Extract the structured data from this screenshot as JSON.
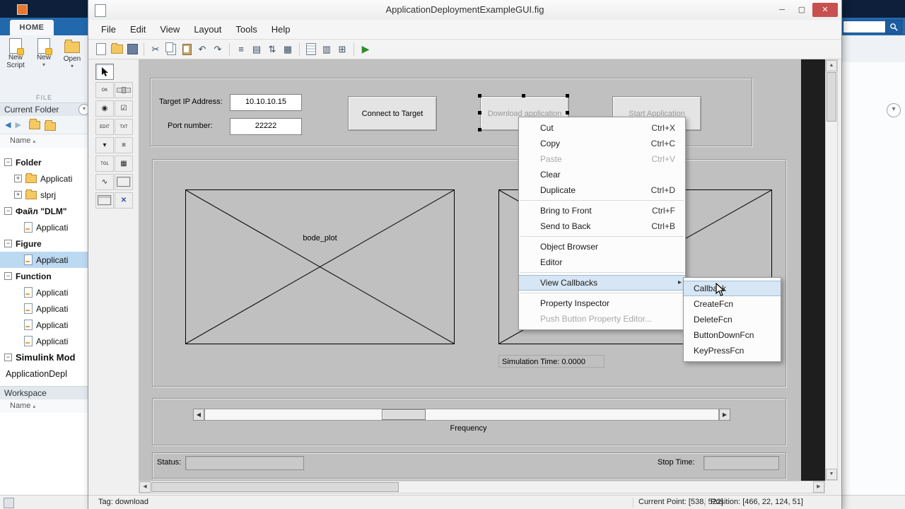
{
  "colors": {
    "titlebar_navy": "#0d1f3a",
    "ribbon_blue": "#2268ad",
    "close_red": "#c75050",
    "canvas_gray": "#c0c0c0",
    "selection_blue": "#bcd9f2",
    "menu_highlight": "#d7e6f4",
    "run_green": "#2e8b2e"
  },
  "glyphs": {
    "minimize": "─",
    "maximize": "▢",
    "close": "✕",
    "sort_asc": "▴",
    "dropdown": "▾",
    "submenu_arrow": "▸",
    "up": "▲",
    "down": "▼",
    "left": "◀",
    "right": "▶",
    "back": "◀",
    "forward": "▶",
    "cut": "✂",
    "undo": "↶",
    "redo": "↷",
    "run": "▶",
    "align": "≡",
    "menu_editor": "▤",
    "tab_order": "⇅",
    "toolbar_editor": "▦",
    "prop_inspector": "▥",
    "obj_browser": "⊞",
    "help_circle": "▾"
  },
  "matlab": {
    "ribbon": {
      "tab_home": "HOME",
      "new_script_line1": "New",
      "new_script_line2": "Script",
      "new_label": "New",
      "open_label": "Open",
      "section_file": "FILE"
    },
    "current_folder": {
      "title": "Current Folder",
      "name_header": "Name",
      "rows": [
        {
          "label": "Folder",
          "expander": "−"
        },
        {
          "label": "Applicati",
          "expander": "+"
        },
        {
          "label": "slprj",
          "expander": "+"
        },
        {
          "label": "Файл \"DLM\"",
          "expander": "−"
        },
        {
          "label": "Applicati",
          "expander": ""
        },
        {
          "label": "Figure",
          "expander": "−"
        },
        {
          "label": "Applicati",
          "expander": ""
        },
        {
          "label": "Function",
          "expander": "−"
        },
        {
          "label": "Applicati",
          "expander": ""
        },
        {
          "label": "Applicati",
          "expander": ""
        },
        {
          "label": "Applicati",
          "expander": ""
        },
        {
          "label": "Applicati",
          "expander": ""
        },
        {
          "label": "Simulink Mod",
          "expander": "−"
        },
        {
          "label": "ApplicationDepl",
          "expander": ""
        }
      ]
    },
    "workspace": {
      "title": "Workspace",
      "name_header": "Name"
    }
  },
  "guide": {
    "window_title": "ApplicationDeploymentExampleGUI.fig",
    "menubar": [
      "File",
      "Edit",
      "View",
      "Layout",
      "Tools",
      "Help"
    ],
    "palette": [
      {
        "name": "select-tool",
        "glyph": ""
      },
      {
        "name": "push-button-tool",
        "glyph": "OK"
      },
      {
        "name": "slider-tool",
        "glyph": ""
      },
      {
        "name": "radio-button-tool",
        "glyph": "◉"
      },
      {
        "name": "check-box-tool",
        "glyph": "☑"
      },
      {
        "name": "edit-text-tool",
        "glyph": "EDIT"
      },
      {
        "name": "static-text-tool",
        "glyph": "TXT"
      },
      {
        "name": "pop-up-menu-tool",
        "glyph": "▾"
      },
      {
        "name": "listbox-tool",
        "glyph": "≡"
      },
      {
        "name": "toggle-button-tool",
        "glyph": "TGL"
      },
      {
        "name": "table-tool",
        "glyph": "▦"
      },
      {
        "name": "axes-tool",
        "glyph": "∿"
      },
      {
        "name": "panel-tool",
        "glyph": ""
      },
      {
        "name": "button-group-tool",
        "glyph": ""
      },
      {
        "name": "activex-tool",
        "glyph": "✕"
      }
    ],
    "canvas": {
      "target_ip_label": "Target IP Address:",
      "target_ip_value": "10.10.10.15",
      "port_label": "Port number:",
      "port_value": "22222",
      "connect_button": "Connect to Target",
      "download_button": "Download application",
      "start_button": "Start Application",
      "axes_tag": "bode_plot",
      "simulation_time": "Simulation Time: 0.0000",
      "frequency_label": "Frequency",
      "status_label": "Status:",
      "stop_time_label": "Stop Time:"
    },
    "context_menu": [
      {
        "label": "Cut",
        "shortcut": "Ctrl+X"
      },
      {
        "label": "Copy",
        "shortcut": "Ctrl+C"
      },
      {
        "label": "Paste",
        "shortcut": "Ctrl+V"
      },
      {
        "label": "Clear",
        "shortcut": ""
      },
      {
        "label": "Duplicate",
        "shortcut": "Ctrl+D"
      },
      {
        "label": "Bring to Front",
        "shortcut": "Ctrl+F"
      },
      {
        "label": "Send to Back",
        "shortcut": "Ctrl+B"
      },
      {
        "label": "Object Browser",
        "shortcut": ""
      },
      {
        "label": "Editor",
        "shortcut": ""
      },
      {
        "label": "View Callbacks",
        "shortcut": ""
      },
      {
        "label": "Property Inspector",
        "shortcut": ""
      },
      {
        "label": "Push Button Property Editor...",
        "shortcut": ""
      }
    ],
    "callbacks_submenu": [
      {
        "label": "Callback"
      },
      {
        "label": "CreateFcn"
      },
      {
        "label": "DeleteFcn"
      },
      {
        "label": "ButtonDownFcn"
      },
      {
        "label": "KeyPressFcn"
      }
    ],
    "statusbar": {
      "tag": "Tag: download",
      "current_point": "Current Point:  [538, 522]",
      "position": "Position:  [466, 22, 124, 51]"
    }
  }
}
